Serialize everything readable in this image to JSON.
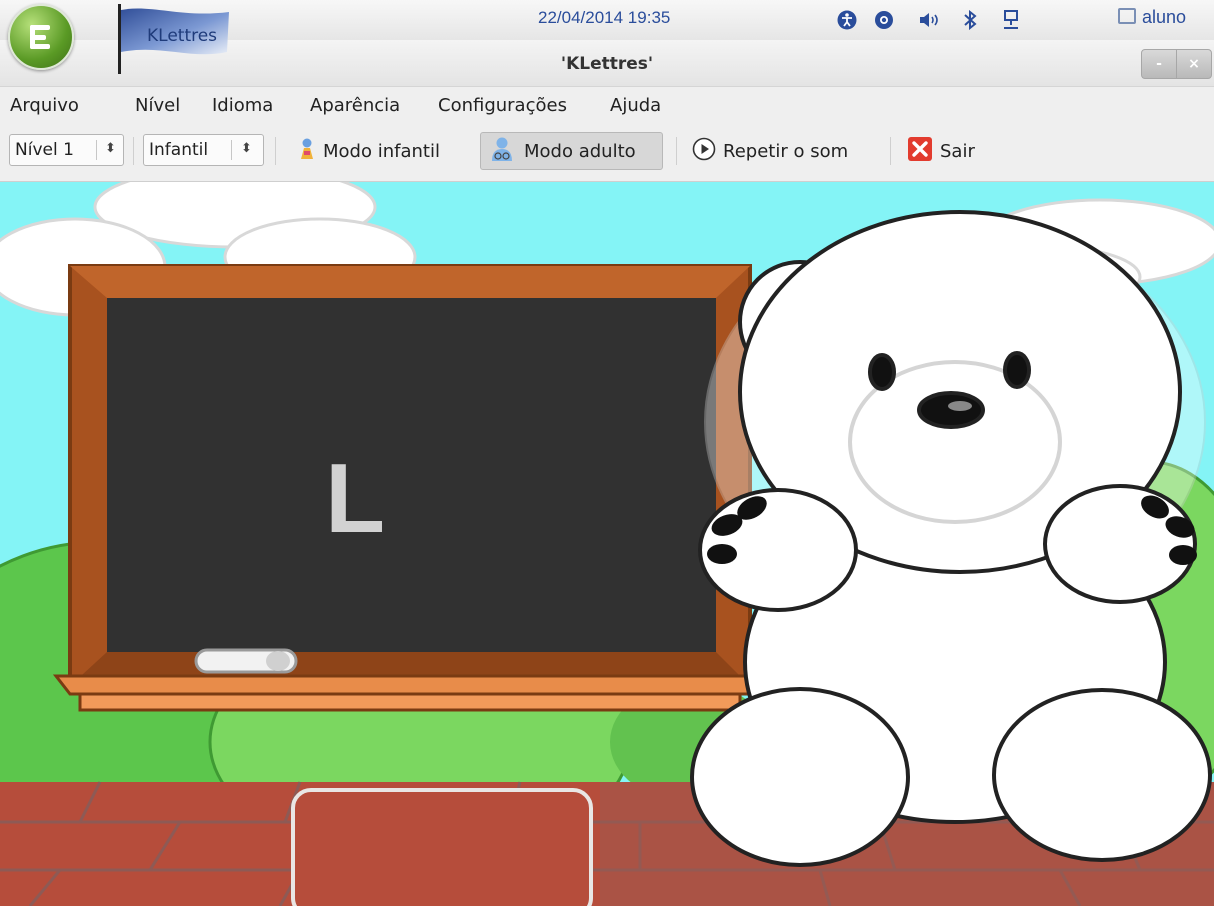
{
  "panel": {
    "app_flag_label": "KLettres",
    "datetime": "22/04/2014 19:35",
    "tray_icons": [
      "accessibility-icon",
      "lifebuoy-icon",
      "volume-icon",
      "bluetooth-icon",
      "network-icon"
    ],
    "user": "aluno"
  },
  "window": {
    "title": "'KLettres'",
    "minimize_label": "-",
    "close_label": "×"
  },
  "menu": {
    "items": [
      "Arquivo",
      "Nível",
      "Idioma",
      "Aparência",
      "Configurações",
      "Ajuda"
    ]
  },
  "toolbar": {
    "level_select": "Nível 1",
    "language_select": "Infantil",
    "kid_mode_label": "Modo infantil",
    "adult_mode_label": "Modo adulto",
    "repeat_sound_label": "Repetir o som",
    "quit_label": "Sair"
  },
  "board": {
    "letter": "L"
  },
  "input_box": {
    "value": ""
  },
  "colors": {
    "sky": "#84f4f6",
    "board_frame": "#a8521f",
    "board_surface": "#313131",
    "bricks": "#b64d3b",
    "accent_text": "#2a4d9b"
  }
}
